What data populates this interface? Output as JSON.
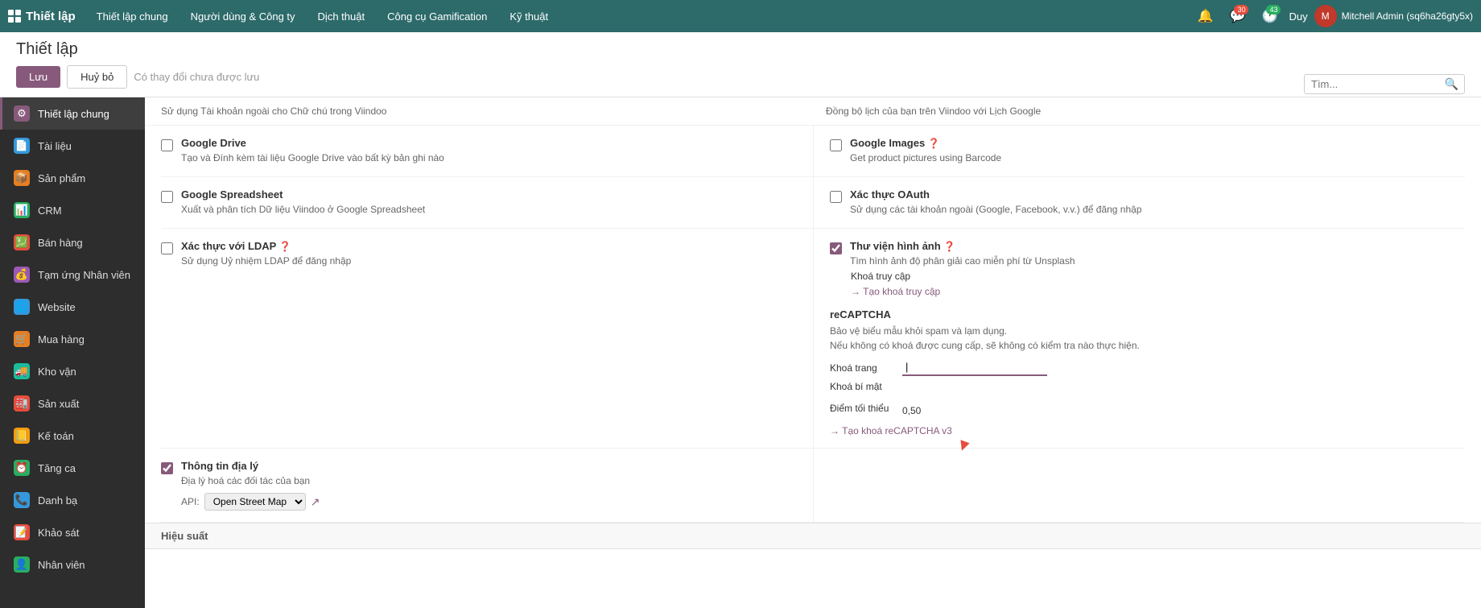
{
  "navbar": {
    "brand": "Thiết lập",
    "menu": [
      "Thiết lập chung",
      "Người dùng & Công ty",
      "Dịch thuật",
      "Công cụ Gamification",
      "Kỹ thuật"
    ],
    "search_placeholder": "Tìm...",
    "user_name": "Duy",
    "admin_name": "Mitchell Admin (sq6ha26gty5x)",
    "msg_count": "30",
    "notif_count": "43"
  },
  "page": {
    "title": "Thiết lập",
    "save_label": "Lưu",
    "cancel_label": "Huỷ bỏ",
    "unsaved_label": "Có thay đổi chưa được lưu"
  },
  "sidebar": {
    "items": [
      {
        "label": "Thiết lập chung",
        "icon": "⚙",
        "color": "#875a7b",
        "active": true
      },
      {
        "label": "Tài liệu",
        "icon": "📄",
        "color": "#3498db"
      },
      {
        "label": "Sản phẩm",
        "icon": "📦",
        "color": "#e67e22"
      },
      {
        "label": "CRM",
        "icon": "📊",
        "color": "#27ae60"
      },
      {
        "label": "Bán hàng",
        "icon": "💹",
        "color": "#e74c3c"
      },
      {
        "label": "Tạm ứng Nhân viên",
        "icon": "💰",
        "color": "#9b59b6"
      },
      {
        "label": "Website",
        "icon": "🌐",
        "color": "#3498db"
      },
      {
        "label": "Mua hàng",
        "icon": "🛒",
        "color": "#e67e22"
      },
      {
        "label": "Kho vận",
        "icon": "🚚",
        "color": "#1abc9c"
      },
      {
        "label": "Sản xuất",
        "icon": "🏭",
        "color": "#e74c3c"
      },
      {
        "label": "Kế toán",
        "icon": "📒",
        "color": "#f39c12"
      },
      {
        "label": "Tăng ca",
        "icon": "⏰",
        "color": "#27ae60"
      },
      {
        "label": "Danh bạ",
        "icon": "📞",
        "color": "#3498db"
      },
      {
        "label": "Khảo sát",
        "icon": "📝",
        "color": "#e74c3c"
      },
      {
        "label": "Nhân viên",
        "icon": "👤",
        "color": "#27ae60"
      }
    ]
  },
  "settings": {
    "google_drive": {
      "title": "Google Drive",
      "desc": "Tạo và Đính kèm tài liệu Google Drive vào bất kỳ bản ghi nào",
      "checked": false
    },
    "google_spreadsheet": {
      "title": "Google Spreadsheet",
      "desc": "Xuất và phân tích Dữ liệu Viindoo ở Google Spreadsheet",
      "checked": false
    },
    "ldap": {
      "title": "Xác thực với LDAP",
      "help": "?",
      "desc": "Sử dụng Uỷ nhiệm LDAP để đăng nhập",
      "checked": false
    },
    "location": {
      "title": "Thông tin địa lý",
      "desc": "Địa lý hoá các đối tác của bạn",
      "checked": true,
      "api_label": "API:",
      "api_value": "Open Street Map"
    },
    "google_images": {
      "title": "Google Images",
      "help": "?",
      "desc": "Get product pictures using Barcode",
      "checked": false
    },
    "oauth": {
      "title": "Xác thực OAuth",
      "desc": "Sử dụng các tài khoản ngoài (Google, Facebook, v.v.) để đăng nhập",
      "checked": false
    },
    "image_library": {
      "title": "Thư viện hình ảnh",
      "help": "?",
      "desc": "Tìm hình ảnh độ phân giải cao miễn phí từ Unsplash",
      "checked": true,
      "access_key_label": "Khoá truy cập",
      "access_key_link": "→ Tạo khoá truy cập"
    },
    "recaptcha": {
      "title": "reCAPTCHA",
      "desc1": "Bảo vệ biểu mẫu khỏi spam và lạm dụng.",
      "desc2": "Nếu không có khoá được cung cấp, sẽ không có kiểm tra nào thực hiện.",
      "site_key_label": "Khoá trang",
      "secret_key_label": "Khoá bí mật",
      "min_score_label": "Điểm tối thiểu",
      "min_score_value": "0,50",
      "create_link": "→ Tạo khoá reCAPTCHA v3"
    }
  },
  "section_footer": {
    "label": "Hiệu suất"
  }
}
